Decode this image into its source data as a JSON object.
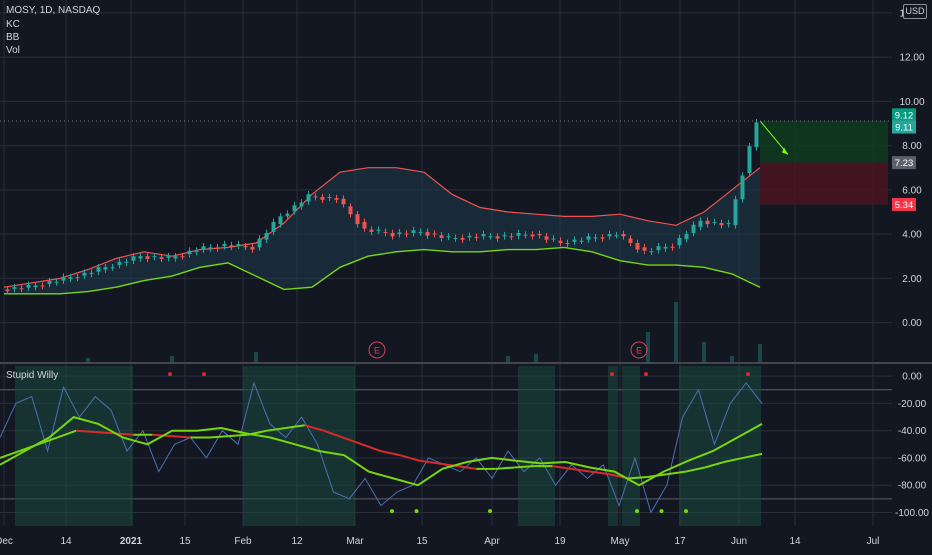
{
  "header": {
    "symbol_line": "MOSY, 1D, NASDAQ",
    "indicators": [
      "KC",
      "BB",
      "Vol"
    ],
    "currency_badge": "USD"
  },
  "colors": {
    "background": "#131722",
    "grid": "#2a2e39",
    "candle_up": "#26a69a",
    "candle_down": "#ef5350",
    "kc_upper": "#ef5350",
    "bb_lower": "#76d70d",
    "bb_fill": "#1e3a4a",
    "oscillator_line": "#4c6fb3",
    "signal_red": "#d62b2b",
    "signal_green": "#76d70d",
    "highlight_band": "#1a4a3f",
    "target_zone": "#0f3b1f",
    "stop_zone": "#4a1420",
    "arrow": "#7bff00"
  },
  "events": [
    "E",
    "E"
  ],
  "lower_pane": {
    "title": "Stupid Willy"
  },
  "chart_data": [
    {
      "type": "candlestick",
      "title": "MOSY, 1D, NASDAQ",
      "y_ticks": [
        "14.00",
        "12.00",
        "10.00",
        "8.00",
        "6.00",
        "4.00",
        "2.00",
        "0.00"
      ],
      "ylim": [
        -1.6,
        14.4
      ],
      "x_ticks": [
        "Dec",
        "14",
        "2021",
        "15",
        "Feb",
        "12",
        "Mar",
        "15",
        "Apr",
        "19",
        "May",
        "17",
        "Jun",
        "14",
        "Jul"
      ],
      "price_labels": [
        {
          "value": 9.12,
          "text": "9.12",
          "color": "#089981"
        },
        {
          "value": 9.11,
          "text": "9.11",
          "color": "#26a69a"
        },
        {
          "value": 7.23,
          "text": "7.23",
          "color": "#5d606b"
        },
        {
          "value": 5.34,
          "text": "5.34",
          "color": "#f23645"
        }
      ],
      "series": [
        {
          "name": "KC upper",
          "values": [
            1.6,
            1.8,
            2.0,
            2.4,
            2.9,
            3.2,
            3.0,
            3.3,
            3.4,
            3.6,
            4.5,
            5.8,
            6.8,
            7.0,
            7.0,
            6.8,
            5.8,
            5.2,
            5.0,
            4.9,
            4.8,
            4.8,
            4.9,
            4.6,
            4.4,
            5.0,
            6.0,
            7.0
          ]
        },
        {
          "name": "BB lower",
          "values": [
            1.3,
            1.3,
            1.3,
            1.4,
            1.6,
            1.9,
            2.1,
            2.5,
            2.7,
            2.1,
            1.5,
            1.6,
            2.5,
            3.0,
            3.2,
            3.3,
            3.2,
            3.2,
            3.3,
            3.3,
            3.4,
            3.2,
            2.8,
            2.6,
            2.6,
            2.5,
            2.2,
            1.6
          ]
        },
        {
          "name": "Close",
          "values": [
            1.5,
            1.6,
            1.9,
            2.2,
            2.6,
            3.0,
            2.9,
            3.3,
            3.5,
            3.4,
            4.8,
            5.7,
            5.6,
            4.2,
            4.0,
            4.1,
            3.8,
            3.9,
            3.9,
            4.0,
            3.6,
            3.8,
            4.0,
            3.2,
            3.5,
            4.6,
            4.4,
            9.1
          ]
        }
      ],
      "volume": [
        0,
        0,
        0,
        0.2,
        0,
        0,
        0.3,
        0,
        0,
        0.5,
        0,
        0,
        0,
        0,
        0,
        0,
        0,
        0,
        0.3,
        0.4,
        0,
        0,
        0,
        1.5,
        3.0,
        1.0,
        0.3,
        0.9
      ],
      "trade_box": {
        "entry": 9.12,
        "target": 7.23,
        "stop": 5.34
      },
      "xlabel": "",
      "ylabel": ""
    },
    {
      "type": "line",
      "title": "Stupid Willy",
      "y_ticks": [
        "0.00",
        "-20.00",
        "-40.00",
        "-60.00",
        "-80.00",
        "-100.00"
      ],
      "ylim": [
        -107,
        6
      ],
      "series": [
        {
          "name": "",
          "values": [
            -45,
            -20,
            -15,
            -55,
            -8,
            -30,
            -15,
            -25,
            -55,
            -40,
            -70,
            -50,
            -45,
            -60,
            -40,
            -50,
            -5,
            -35,
            -45,
            -30,
            -50,
            -85,
            -90,
            -75,
            -95,
            -85,
            -80,
            -60,
            -65,
            -70,
            -60,
            -75,
            -55,
            -70,
            -60,
            -80,
            -65,
            -75,
            -65,
            -95,
            -60,
            -100,
            -80,
            -30,
            -10,
            -50,
            -20,
            -5,
            -20
          ]
        },
        {
          "name": "",
          "values": [
            -65,
            -55,
            -45,
            -30,
            -35,
            -45,
            -50,
            -40,
            -40,
            -38,
            -42,
            -45,
            -50,
            -55,
            -58,
            -70,
            -75,
            -80,
            -68,
            -63,
            -60,
            -62,
            -64,
            -63,
            -67,
            -70,
            -80,
            -70,
            -62,
            -55,
            -45,
            -35
          ]
        },
        {
          "name": "",
          "values": [
            -60,
            -55,
            -50,
            -45,
            -40,
            -41,
            -42,
            -43,
            -43,
            -44,
            -45,
            -45,
            -44,
            -43,
            -40,
            -38,
            -36,
            -40,
            -45,
            -50,
            -55,
            -58,
            -62,
            -64,
            -66,
            -68,
            -68,
            -67,
            -66,
            -66,
            -68,
            -70,
            -72,
            -75,
            -74,
            -72,
            -70,
            -67,
            -63,
            -60,
            -57
          ]
        }
      ],
      "markers_top": [
        5,
        6,
        18,
        19,
        22
      ],
      "markers_bottom": [
        16,
        17,
        20,
        26,
        27,
        28
      ]
    }
  ]
}
